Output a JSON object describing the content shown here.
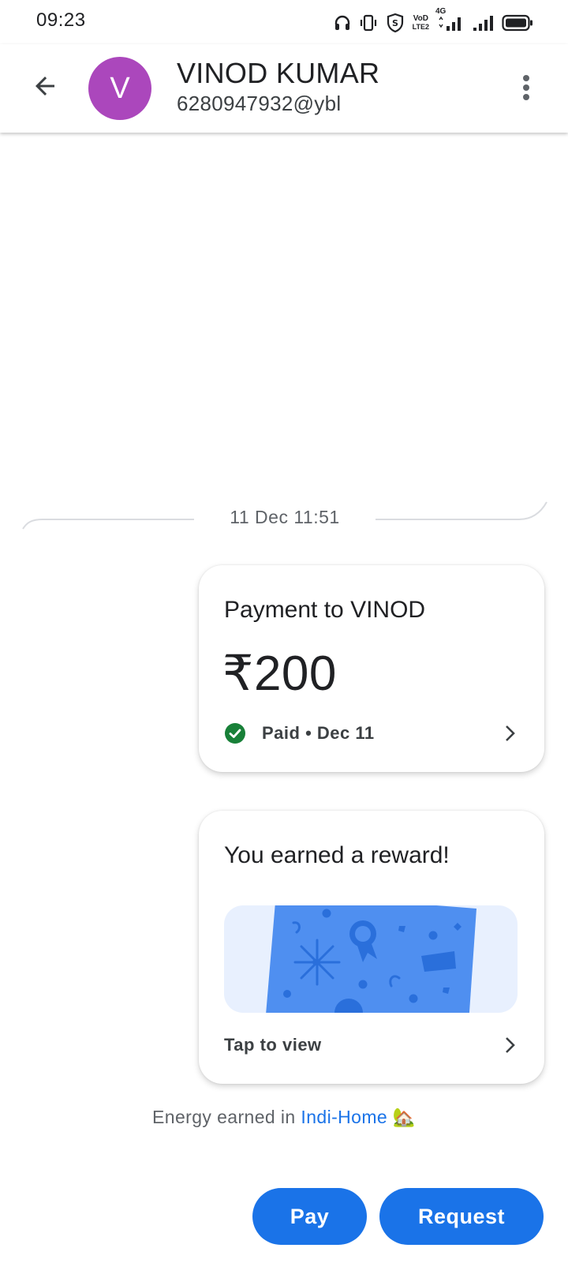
{
  "status_bar": {
    "time": "09:23",
    "icons": [
      "headset-icon",
      "vibrate-icon",
      "shield-s-icon",
      "volte-icon",
      "4g-signal-icon",
      "signal-icon",
      "battery-icon"
    ],
    "volte_label_top": "VoD",
    "volte_label_bottom": "LTE2",
    "network_label": "4G"
  },
  "header": {
    "avatar_letter": "V",
    "avatar_color": "#ab47bc",
    "name": "VINOD KUMAR",
    "upi_id": "6280947932@ybl"
  },
  "conversation": {
    "date_divider": "11 Dec 11:51",
    "payment_card": {
      "title": "Payment to VINOD",
      "amount": "₹200",
      "status": "Paid • Dec 11",
      "status_color": "#188038"
    },
    "reward_card": {
      "title": "You earned a reward!",
      "action": "Tap to view"
    },
    "energy": {
      "prefix": "Energy earned in",
      "link": "Indi-Home",
      "emoji": "🏡"
    }
  },
  "actions": {
    "pay_label": "Pay",
    "request_label": "Request",
    "accent": "#1a73e8"
  }
}
